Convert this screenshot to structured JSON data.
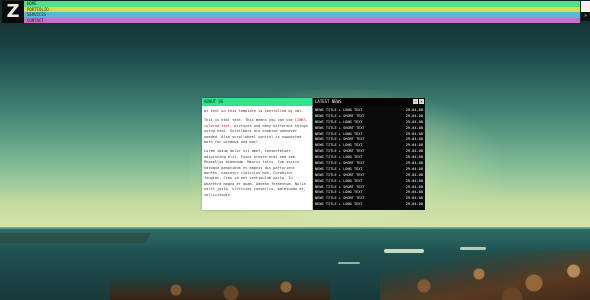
{
  "logo": {
    "letter": "Z"
  },
  "nav": {
    "items": [
      {
        "label": "HOME",
        "color": "#4fe28b"
      },
      {
        "label": "PORTFOLIO",
        "color": "#d3db59"
      },
      {
        "label": "SERVICES",
        "color": "#56b8d4"
      },
      {
        "label": "CONTACT",
        "color": "#c46fd0"
      }
    ],
    "corner_icon": "double-chevron-right-icon",
    "corner_glyph": "»"
  },
  "about": {
    "title": "ABOUT US",
    "p1": "at text on this template is controlled by xml.",
    "p2_pre": "This is html text. This means you can use ",
    "p2_link": "LINKS",
    "p2_mid": ", colored text",
    "p2_post": ", pictures and many different things using html. Scrollbars are enabled whenever needed. Also scrollwheel control is supported both for windows and mac!",
    "p3": "Lorem ipsum dolor sit amet, consectetuer adipiscing elit. Fusce ornare erat sed sem. Phasellus bibendum. Mauris felis. Cum sociis natoque penatibus et magnis dis parturient montes, nascetur ridiculus mus. Curabitur feugiat. Cras id est vestibulum porta. In pharetra magna et quam. Aenean fermentum. Nulla velit justo, ultricies convallis, malesuada at, sollicitudin"
  },
  "news": {
    "title": "LATEST NEWS",
    "controls": [
      {
        "icon": "minimize-icon",
        "glyph": "–"
      },
      {
        "icon": "close-icon",
        "glyph": "×"
      }
    ],
    "items": [
      {
        "title": "NEWS TITLE + LONG TEXT",
        "date": "29-04-08"
      },
      {
        "title": "NEWS TITLE + SHORT TEXT",
        "date": "29-04-08"
      },
      {
        "title": "NEWS TITLE + LONG TEXT",
        "date": "29-04-08"
      },
      {
        "title": "NEWS TITLE + SHORT TEXT",
        "date": "29-04-08"
      },
      {
        "title": "NEWS TITLE + LONG TEXT",
        "date": "29-04-08"
      },
      {
        "title": "NEWS TITLE + SHORT TEXT",
        "date": "29-04-08"
      },
      {
        "title": "NEWS TITLE + LONG TEXT",
        "date": "29-04-08"
      },
      {
        "title": "NEWS TITLE + SHORT TEXT",
        "date": "29-04-08"
      },
      {
        "title": "NEWS TITLE + LONG TEXT",
        "date": "29-04-08"
      },
      {
        "title": "NEWS TITLE + SHORT TEXT",
        "date": "29-04-08"
      },
      {
        "title": "NEWS TITLE + LONG TEXT",
        "date": "29-04-08"
      },
      {
        "title": "NEWS TITLE + SHORT TEXT",
        "date": "29-04-08"
      },
      {
        "title": "NEWS TITLE + LONG TEXT",
        "date": "29-04-08"
      },
      {
        "title": "NEWS TITLE + SHORT TEXT",
        "date": "29-04-08"
      },
      {
        "title": "NEWS TITLE + LONG TEXT",
        "date": "29-04-08"
      },
      {
        "title": "NEWS TITLE + SHORT TEXT",
        "date": "29-04-08"
      },
      {
        "title": "NEWS TITLE + LONG TEXT",
        "date": "29-04-08"
      }
    ]
  }
}
